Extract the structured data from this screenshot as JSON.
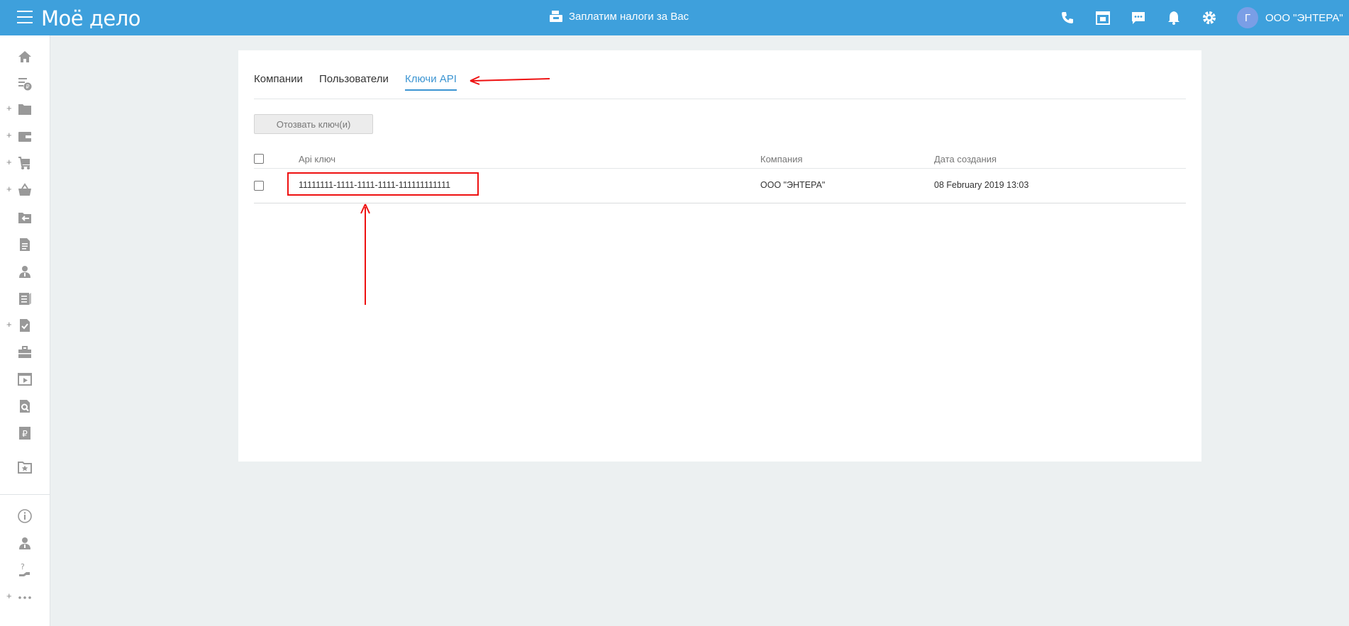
{
  "header": {
    "logo": "Моё дело",
    "promo": "Заплатим налоги за Вас",
    "icons": [
      "phone-icon",
      "calendar-icon",
      "chat-icon",
      "bell-icon",
      "gear-icon"
    ],
    "user": {
      "avatar_letter": "Г",
      "name": "ООО \"ЭНТЕРА\""
    }
  },
  "sidebar": {
    "items": [
      "home-icon",
      "invoice-icon",
      "folder-icon",
      "wallet-icon",
      "cart-icon",
      "basket-icon",
      "transfer-icon",
      "document-icon",
      "employee-icon",
      "report-icon",
      "tasks-icon",
      "briefcase-icon",
      "video-icon",
      "search-doc-icon",
      "ruble-icon",
      "starred-folder-icon"
    ],
    "bottom_items": [
      "info-icon",
      "support-icon",
      "help-icon",
      "more-icon"
    ]
  },
  "tabs": [
    {
      "label": "Компании",
      "active": false
    },
    {
      "label": "Пользователи",
      "active": false
    },
    {
      "label": "Ключи API",
      "active": true
    }
  ],
  "revoke_button": "Отозвать ключ(и)",
  "table": {
    "headers": {
      "key": "Api ключ",
      "company": "Компания",
      "date": "Дата создания"
    },
    "rows": [
      {
        "key": "11111111-1111-1111-1111-111111111111",
        "company": "ООО \"ЭНТЕРА\"",
        "date": "08 February 2019 13:03"
      }
    ]
  },
  "colors": {
    "header": "#3ea0dc",
    "accent": "#3c95d2",
    "annotation": "#e11111"
  }
}
